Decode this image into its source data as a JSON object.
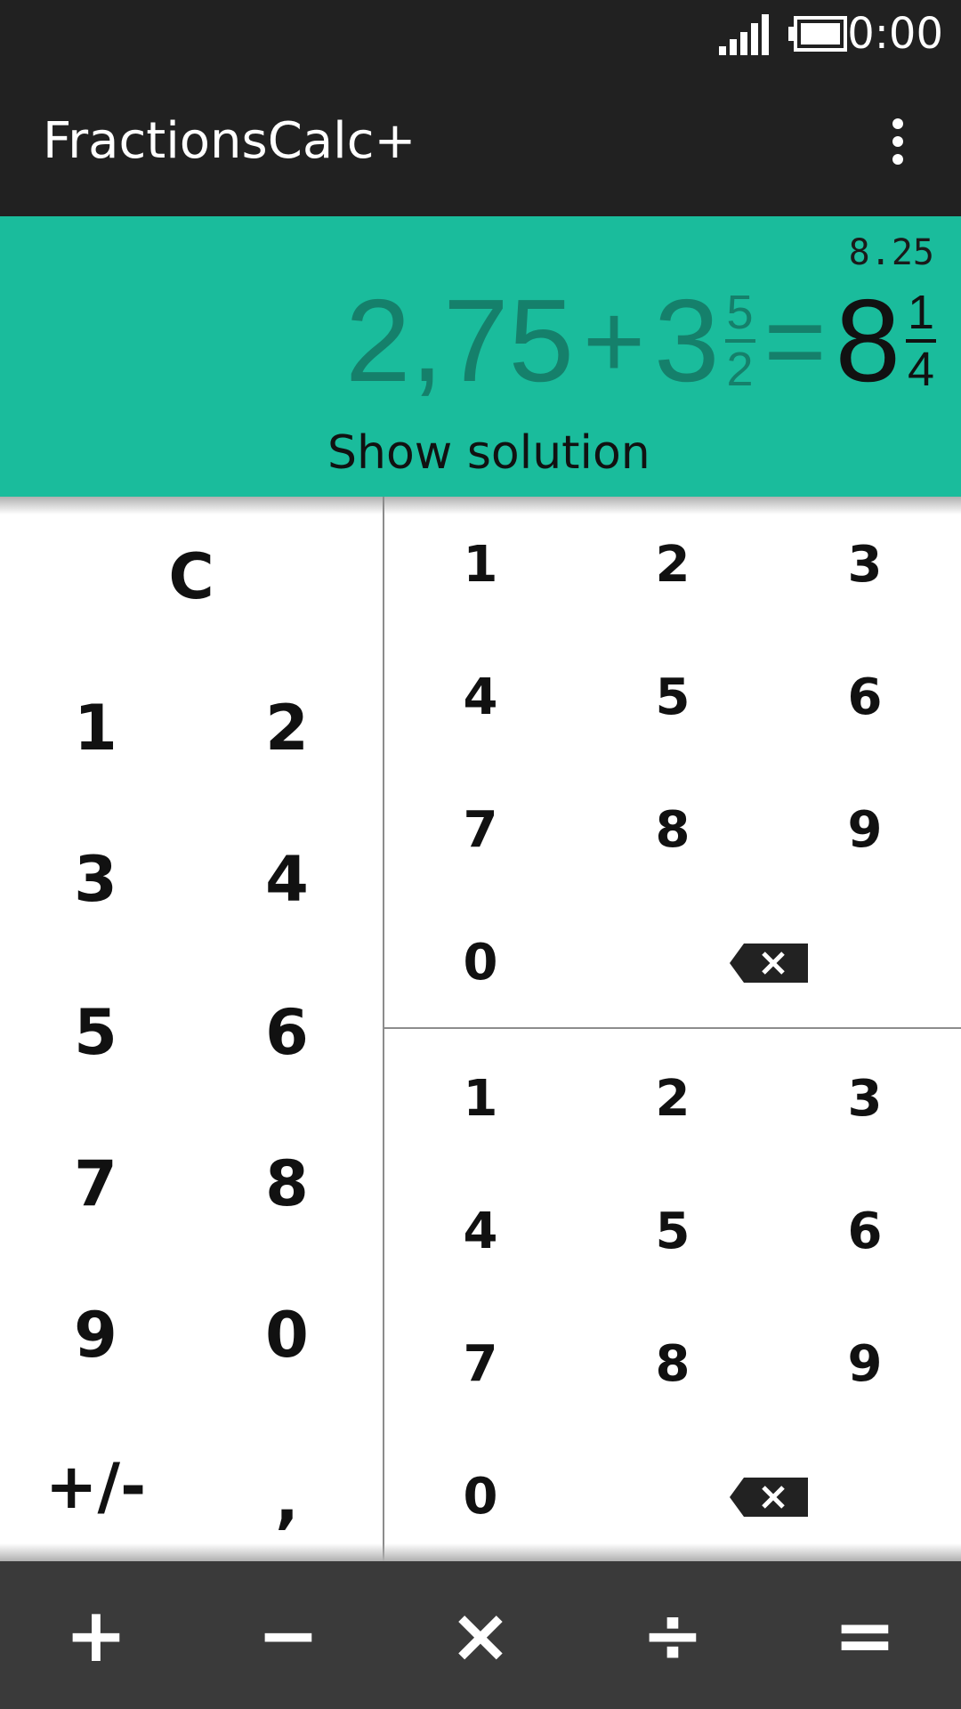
{
  "status_bar": {
    "time": "0:00",
    "signal_icon": "signal-icon",
    "battery_icon": "battery-icon"
  },
  "action_bar": {
    "title": "FractionsCalc+",
    "overflow_icon": "more-vert-icon"
  },
  "display": {
    "decimal_result": "8.25",
    "operand1": "2,75",
    "operator": "+",
    "operand2_whole": "3",
    "operand2_num": "5",
    "operand2_den": "2",
    "equals": "=",
    "result_whole": "8",
    "result_num": "1",
    "result_den": "4",
    "show_solution": "Show solution",
    "accent_color": "#1abc9c"
  },
  "left_pad": {
    "clear": "C",
    "keys": [
      "1",
      "2",
      "3",
      "4",
      "5",
      "6",
      "7",
      "8",
      "9",
      "0",
      "+/-",
      ","
    ]
  },
  "numerator_pad": {
    "keys": [
      "1",
      "2",
      "3",
      "4",
      "5",
      "6",
      "7",
      "8",
      "9",
      "0"
    ],
    "backspace_icon": "backspace-icon"
  },
  "denominator_pad": {
    "keys": [
      "1",
      "2",
      "3",
      "4",
      "5",
      "6",
      "7",
      "8",
      "9",
      "0"
    ],
    "backspace_icon": "backspace-icon"
  },
  "operators": {
    "add": "+",
    "subtract": "−",
    "multiply": "×",
    "divide": "÷",
    "equals": "="
  }
}
